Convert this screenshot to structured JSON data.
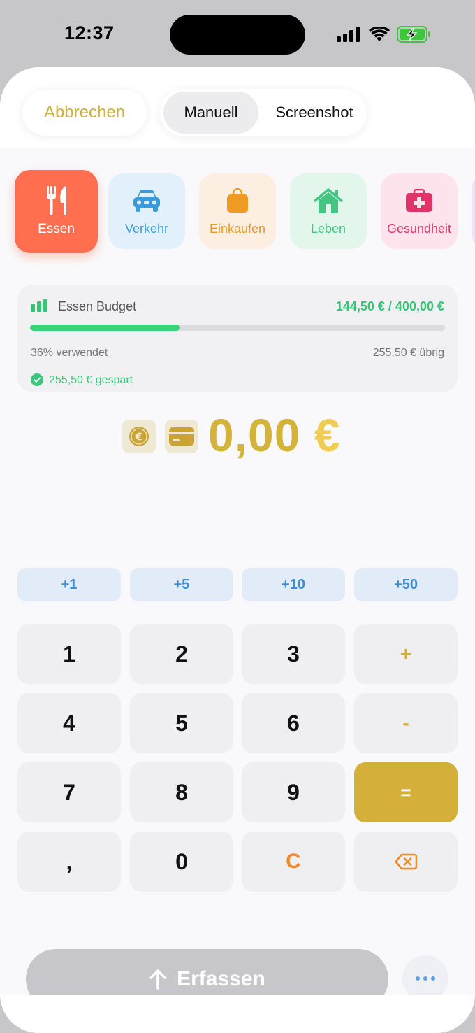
{
  "status": {
    "time": "12:37"
  },
  "header": {
    "cancel_label": "Abbrechen",
    "tabs": [
      {
        "label": "Manuell",
        "selected": true
      },
      {
        "label": "Screenshot",
        "selected": false
      }
    ]
  },
  "categories": [
    {
      "label": "Essen",
      "icon": "fork-knife-icon",
      "color": "#ff6f4f",
      "selected": true
    },
    {
      "label": "Verkehr",
      "icon": "car-icon",
      "color": "#3b9bd9",
      "selected": false
    },
    {
      "label": "Einkaufen",
      "icon": "shopping-bag-icon",
      "color": "#ee9a23",
      "selected": false
    },
    {
      "label": "Leben",
      "icon": "house-icon",
      "color": "#44c582",
      "selected": false
    },
    {
      "label": "Gesundheit",
      "icon": "medical-kit-icon",
      "color": "#e0336a",
      "selected": false
    }
  ],
  "budget": {
    "title": "Essen Budget",
    "amount": "144,50 € / 400,00 €",
    "used_fraction": 0.36,
    "used_label": "36% verwendet",
    "left_label": "255,50 € übrig",
    "saved_label": "255,50 € gespart"
  },
  "amount": {
    "value": "0,00",
    "currency": "€"
  },
  "quick_add": [
    "+1",
    "+5",
    "+10",
    "+50"
  ],
  "keypad": {
    "k1": "1",
    "k2": "2",
    "k3": "3",
    "plus": "+",
    "k4": "4",
    "k5": "5",
    "k6": "6",
    "minus": "-",
    "k7": "7",
    "k8": "8",
    "k9": "9",
    "equals": "=",
    "comma": ",",
    "k0": "0",
    "clear": "C"
  },
  "submit_label": "Erfassen",
  "colors": {
    "accent": "#d4b03b",
    "budget_green": "#35c576",
    "quick_blue": "#3e8ed6",
    "clear_orange": "#f08a2b"
  }
}
